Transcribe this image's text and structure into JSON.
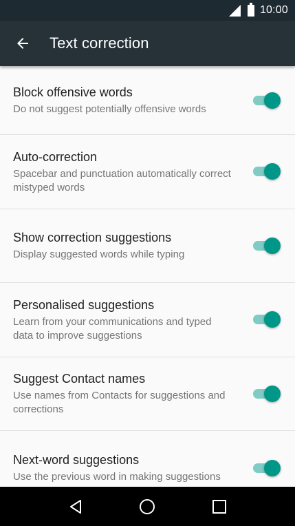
{
  "status_bar": {
    "time": "10:00",
    "signal_icon": "signal-icon",
    "battery_icon": "battery-icon"
  },
  "toolbar": {
    "back_icon": "arrow-back-icon",
    "title": "Text correction"
  },
  "settings": [
    {
      "label": "Block offensive words",
      "summary": "Do not suggest potentially offensive words",
      "enabled": true
    },
    {
      "label": "Auto-correction",
      "summary": "Spacebar and punctuation automatically correct mistyped words",
      "enabled": true
    },
    {
      "label": "Show correction suggestions",
      "summary": "Display suggested words while typing",
      "enabled": true
    },
    {
      "label": "Personalised suggestions",
      "summary": "Learn from your communications and typed data to improve suggestions",
      "enabled": true
    },
    {
      "label": "Suggest Contact names",
      "summary": "Use names from Contacts for suggestions and corrections",
      "enabled": true
    },
    {
      "label": "Next-word suggestions",
      "summary": "Use the previous word in making suggestions",
      "enabled": true
    }
  ],
  "colors": {
    "toolbar_bg": "#263238",
    "accent": "#009688",
    "accent_track": "#80cbc4"
  },
  "nav_bar": {
    "back_icon": "nav-back-icon",
    "home_icon": "nav-home-icon",
    "recents_icon": "nav-recents-icon"
  }
}
